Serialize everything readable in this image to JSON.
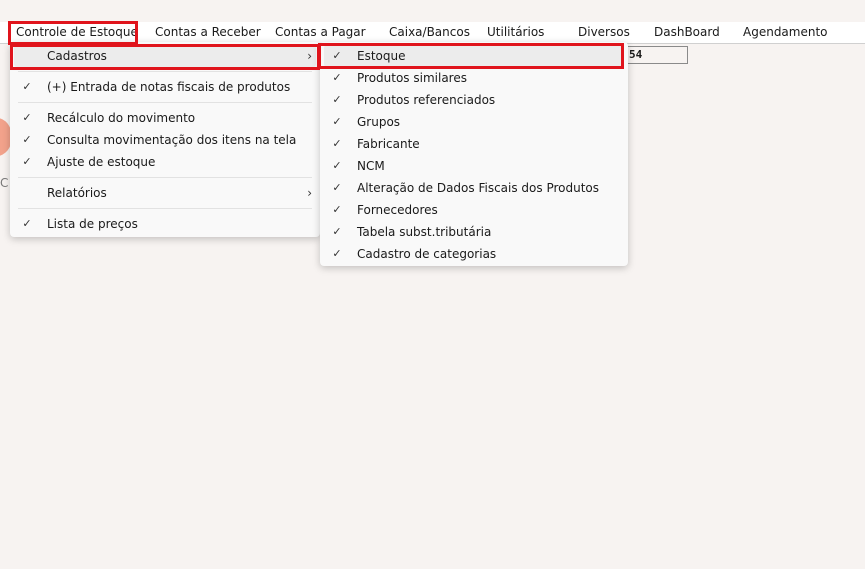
{
  "menubar": {
    "items": [
      {
        "label": "Controle de Estoque"
      },
      {
        "label": "Contas a Receber"
      },
      {
        "label": "Contas a Pagar"
      },
      {
        "label": "Caixa/Bancos"
      },
      {
        "label": "Utilitários"
      },
      {
        "label": "Diversos"
      },
      {
        "label": "DashBoard"
      },
      {
        "label": "Agendamento"
      }
    ]
  },
  "field": {
    "value": "54"
  },
  "main_menu": {
    "items": [
      {
        "label": "Cadastros",
        "has_submenu": true,
        "highlighted": true
      },
      {
        "label": "(+) Entrada de notas fiscais de produtos",
        "checked": true
      },
      {
        "label": "Recálculo do movimento",
        "checked": true
      },
      {
        "label": "Consulta movimentação dos itens na tela",
        "checked": true
      },
      {
        "label": "Ajuste de estoque",
        "checked": true
      },
      {
        "label": "Relatórios",
        "has_submenu": true
      },
      {
        "label": "Lista de preços",
        "checked": true
      }
    ]
  },
  "sub_menu": {
    "items": [
      {
        "label": "Estoque",
        "checked": true,
        "highlighted": true
      },
      {
        "label": "Produtos similares",
        "checked": true
      },
      {
        "label": "Produtos referenciados",
        "checked": true
      },
      {
        "label": "Grupos",
        "checked": true
      },
      {
        "label": "Fabricante",
        "checked": true
      },
      {
        "label": "NCM",
        "checked": true
      },
      {
        "label": "Alteração de Dados Fiscais dos Produtos",
        "checked": true
      },
      {
        "label": "Fornecedores",
        "checked": true
      },
      {
        "label": "Tabela subst.tributária",
        "checked": true
      },
      {
        "label": "Cadastro de categorias",
        "checked": true
      }
    ]
  },
  "colors": {
    "highlight": "#e0141c",
    "background": "#f7f3f1",
    "menu_bg": "#f9f9f9"
  }
}
